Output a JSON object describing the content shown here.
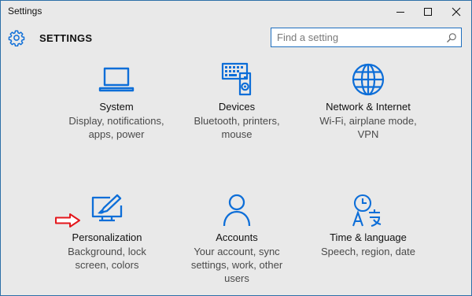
{
  "window": {
    "title": "Settings",
    "controls": {
      "minimize": "minimize-icon",
      "maximize": "maximize-icon",
      "close": "close-icon"
    }
  },
  "header": {
    "title": "SETTINGS",
    "icon": "gear-icon"
  },
  "search": {
    "placeholder": "Find a setting",
    "value": "",
    "icon": "search-icon"
  },
  "tiles": [
    {
      "title": "System",
      "description": "Display, notifications, apps, power",
      "icon": "laptop-icon"
    },
    {
      "title": "Devices",
      "description": "Bluetooth, printers, mouse",
      "icon": "keyboard-speaker-icon"
    },
    {
      "title": "Network & Internet",
      "description": "Wi-Fi, airplane mode, VPN",
      "icon": "globe-icon"
    },
    {
      "title": "Personalization",
      "description": "Background, lock screen, colors",
      "icon": "paintbrush-monitor-icon"
    },
    {
      "title": "Accounts",
      "description": "Your account, sync settings, work, other users",
      "icon": "person-icon"
    },
    {
      "title": "Time & language",
      "description": "Speech, region, date",
      "icon": "clock-language-icon"
    }
  ],
  "annotation": {
    "icon": "red-arrow-icon",
    "color": "#e3171c"
  },
  "colors": {
    "accent": "#0d6ed8",
    "background": "#e9e9e9"
  }
}
